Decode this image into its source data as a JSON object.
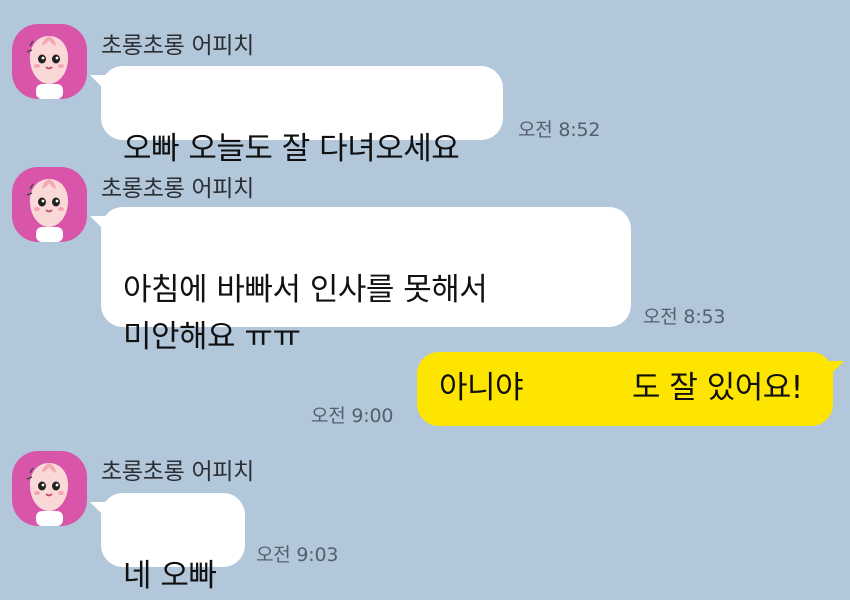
{
  "sender_name": "초롱초롱 어피치",
  "avatar_icon": "apeach-character-icon",
  "colors": {
    "background": "#b2c7da",
    "incoming_bubble": "#ffffff",
    "outgoing_bubble": "#fee500",
    "avatar_bg": "#d855aa"
  },
  "messages": [
    {
      "direction": "incoming",
      "text": "오빠 오늘도 잘 다녀오세요",
      "time": "오전 8:52"
    },
    {
      "direction": "incoming",
      "text": "아침에 바빠서 인사를 못해서\n미안해요 ㅠㅠ",
      "time": "오전 8:53"
    },
    {
      "direction": "outgoing",
      "text_before_gap": "아니야",
      "text_after_gap": "도 잘 있어요!",
      "time": "오전 9:00"
    },
    {
      "direction": "incoming",
      "text": "네 오빠",
      "time": "오전 9:03"
    }
  ]
}
